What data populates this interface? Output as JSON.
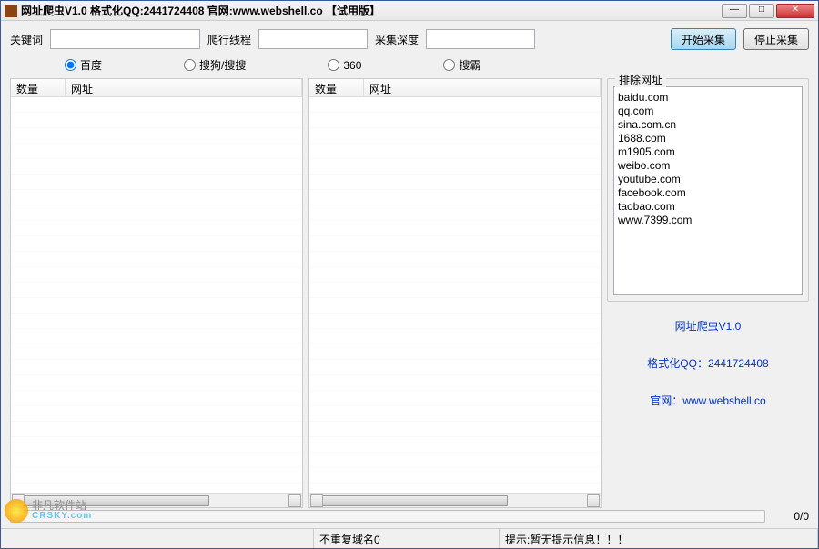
{
  "window": {
    "title": "网址爬虫V1.0 格式化QQ:2441724408 官网:www.webshell.co 【试用版】"
  },
  "inputs": {
    "keyword_label": "关键词",
    "threads_label": "爬行线程",
    "depth_label": "采集深度",
    "keyword_value": "",
    "threads_value": "",
    "depth_value": ""
  },
  "buttons": {
    "start": "开始采集",
    "stop": "停止采集"
  },
  "radios": {
    "baidu": "百度",
    "sogou": "搜狗/搜搜",
    "s360": "360",
    "souba": "搜霸",
    "selected": "baidu"
  },
  "list_headers": {
    "qty": "数量",
    "url": "网址"
  },
  "exclude": {
    "title": "排除网址",
    "items": [
      "baidu.com",
      "qq.com",
      "sina.com.cn",
      "1688.com",
      "m1905.com",
      "weibo.com",
      "youtube.com",
      "facebook.com",
      "taobao.com",
      "www.7399.com"
    ]
  },
  "info": {
    "line1": "网址爬虫V1.0",
    "line2": "格式化QQ：2441724408",
    "line3_label": "官网：",
    "line3_link": "www.webshell.co"
  },
  "progress": {
    "text": "0/0"
  },
  "status": {
    "cell1": "",
    "cell2": "不重复域名0",
    "cell3": "提示:暂无提示信息！！！"
  },
  "watermark": {
    "name": "非凡软件站",
    "domain": "CRSKY.com"
  }
}
